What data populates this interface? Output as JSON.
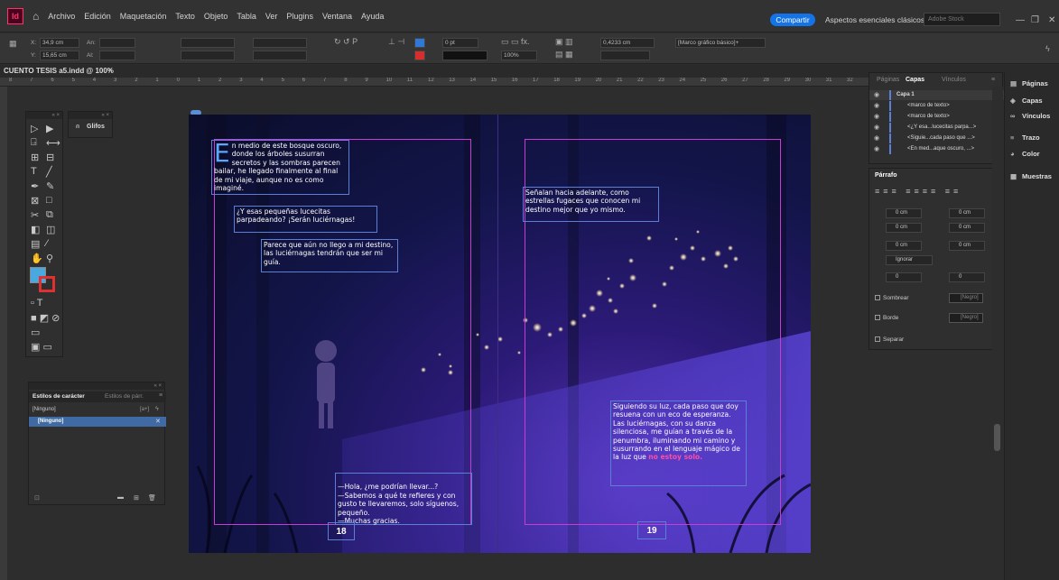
{
  "app": {
    "logo": "Id"
  },
  "menu": [
    "Archivo",
    "Edición",
    "Maquetación",
    "Texto",
    "Objeto",
    "Tabla",
    "Ver",
    "Plugins",
    "Ventana",
    "Ayuda"
  ],
  "header": {
    "share": "Compartir",
    "workspace": "Aspectos esenciales clásicos ⌄",
    "stock_placeholder": "Adobe Stock"
  },
  "controlbar": {
    "x_label": "X:",
    "x_value": "34,9 cm",
    "y_label": "Y:",
    "y_value": "15,65 cm",
    "w_label": "An:",
    "h_label": "Al:",
    "stroke_value": "0 pt",
    "scale_value": "100%",
    "gap_value": "0,4233 cm",
    "frame_style": "[Marco gráfico básico]+"
  },
  "document": {
    "tab": "CUENTO TESIS a5.indd @ 100%"
  },
  "ruler_ticks": [
    "8",
    "7",
    "6",
    "5",
    "4",
    "3",
    "2",
    "1",
    "0",
    "1",
    "2",
    "3",
    "4",
    "5",
    "6",
    "7",
    "8",
    "9",
    "10",
    "11",
    "12",
    "13",
    "14",
    "15",
    "16",
    "17",
    "18",
    "19",
    "20",
    "21",
    "22",
    "23",
    "24",
    "25",
    "26",
    "27",
    "28",
    "29",
    "30",
    "31",
    "32"
  ],
  "spread": {
    "frame1_dropcap": "E",
    "frame1": "n medio de este bosque oscuro, donde los árboles susurran secretos y las sombras parecen bailar, he llegado finalmente al final de mi viaje, aunque no es como imaginé.",
    "frame2": "¿Y esas pequeñas lucecitas parpadeando? ¡Serán luciérnagas!",
    "frame3": "Parece que aún no llego a mi destino, las luciérnagas tendrán que ser mi guía.",
    "frame4": "—Hola, ¿me podrían llevar...?\n—Sabemos a qué te refieres y con gusto te llevaremos, solo síguenos, pequeño.\n—Muchas gracias.",
    "frame5": "Señalan hacia adelante, como estrellas fugaces que conocen mi destino mejor que yo mismo.",
    "frame6_main": "Siguiendo su luz, cada paso que doy resuena con un eco de esperanza. Las luciérnagas, con su danza silenciosa, me guían a través de la penumbra, iluminando mi camino y susurrando en el lenguaje mágico de la luz que ",
    "frame6_highlight": "no estoy solo.",
    "page_left": "18",
    "page_right": "19"
  },
  "glyphs_panel": {
    "title": "Glifos"
  },
  "char_styles": {
    "tab1": "Estilos de carácter",
    "tab2": "Estilos de párr.",
    "row_header": "[Ninguno]",
    "row_header_shortcut": "[a+]",
    "row_selected": "[Ninguno]"
  },
  "layers": {
    "tabs": [
      "Páginas",
      "Capas",
      "Vínculos"
    ],
    "rows": [
      "Capa 1",
      "<marco de texto>",
      "<marco de texto>",
      "<¿Y esa...lucecitas parpa...>",
      "<Siguie...cada paso que ...>",
      "<En med...aque oscuro, ...>"
    ]
  },
  "paragraph": {
    "title": "Párrafo",
    "fields": [
      "0 cm",
      "0 cm",
      "0 cm",
      "0 cm",
      "0 cm",
      "0 cm",
      "Ignorar",
      "0",
      "0"
    ],
    "shading": "Sombrear",
    "border": "Borde",
    "split": "Separar",
    "swatch": "[Negro]"
  },
  "dock": [
    "Páginas",
    "Capas",
    "Vínculos",
    "Trazo",
    "Color",
    "Muestras"
  ],
  "colors": {
    "accent": "#1473e6",
    "frame": "#5c7fd6",
    "margin": "#c93bd1",
    "highlight": "#ff4da6"
  }
}
